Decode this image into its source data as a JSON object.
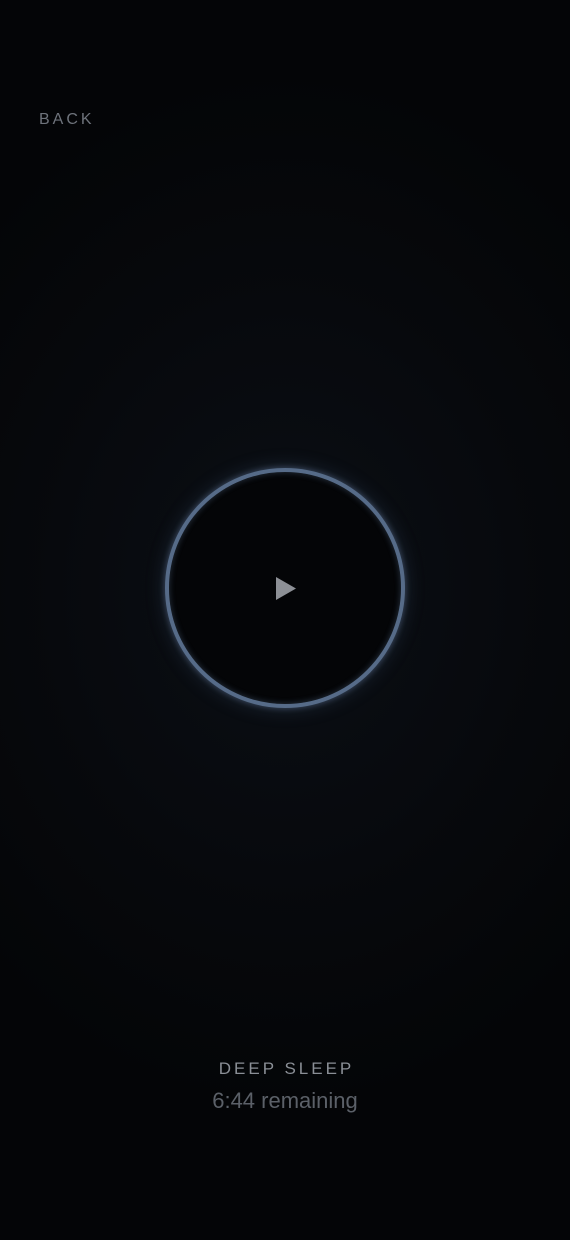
{
  "nav": {
    "back_label": "BACK"
  },
  "player": {
    "play_icon": "play-icon",
    "state": "paused",
    "ring_color": "#566b88"
  },
  "track": {
    "title": "DEEP SLEEP",
    "remaining": "6:44 remaining"
  },
  "theme": {
    "background": "#050608",
    "text_muted": "#6e737b"
  }
}
